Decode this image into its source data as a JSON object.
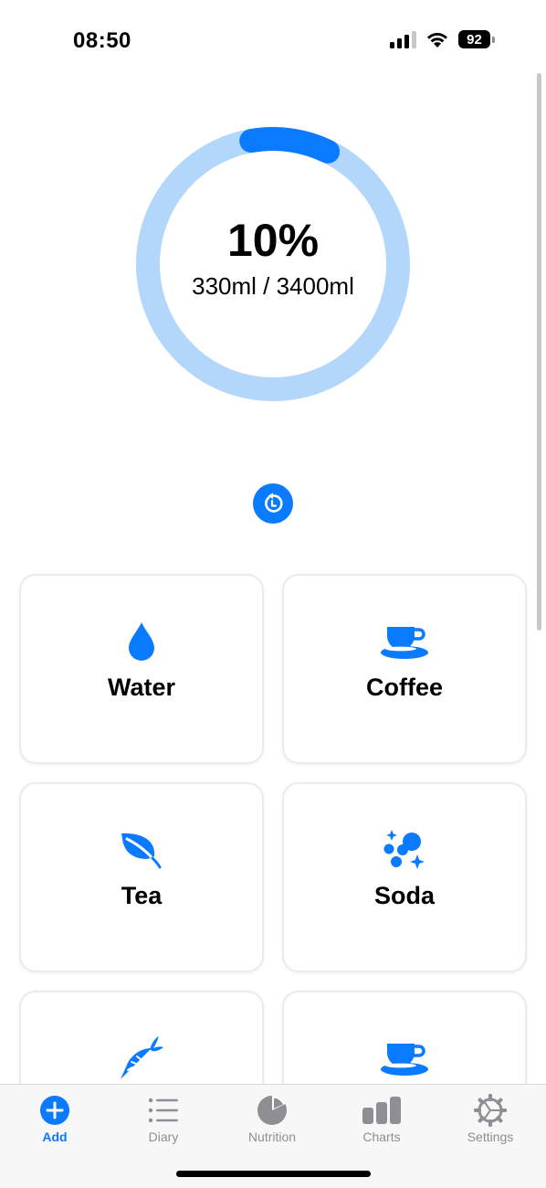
{
  "status_bar": {
    "time": "08:50",
    "battery": "92",
    "icons": [
      "cellular-signal-icon",
      "wifi-icon",
      "battery-icon"
    ]
  },
  "progress": {
    "percent_label": "10%",
    "amount_label": "330ml / 3400ml",
    "fraction": 0.1,
    "track_color": "#b3d6fb",
    "fill_color": "#0a7aff"
  },
  "reset": {
    "icon": "reset-arrow-icon"
  },
  "drinks": [
    {
      "label": "Water",
      "icon": "water-drop-icon"
    },
    {
      "label": "Coffee",
      "icon": "coffee-cup-icon"
    },
    {
      "label": "Tea",
      "icon": "leaf-icon"
    },
    {
      "label": "Soda",
      "icon": "bubbles-icon"
    },
    {
      "label": "",
      "icon": "carrot-icon"
    },
    {
      "label": "",
      "icon": "cup-icon"
    }
  ],
  "tabs": [
    {
      "label": "Add",
      "icon": "add-circle-icon",
      "active": true
    },
    {
      "label": "Diary",
      "icon": "list-icon",
      "active": false
    },
    {
      "label": "Nutrition",
      "icon": "pie-chart-icon",
      "active": false
    },
    {
      "label": "Charts",
      "icon": "bar-chart-icon",
      "active": false
    },
    {
      "label": "Settings",
      "icon": "gear-icon",
      "active": false
    }
  ],
  "colors": {
    "accent": "#0a7aff",
    "inactive": "#8e8e93"
  }
}
